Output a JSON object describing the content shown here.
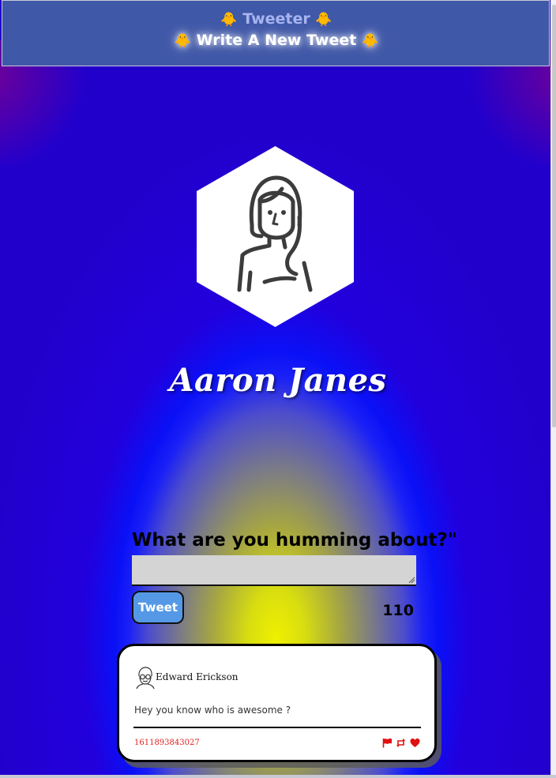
{
  "nav": {
    "logo_label": "Tweeter",
    "write_link_label": "Write A New Tweet",
    "chick_emoji": "🐥"
  },
  "profile": {
    "name": "Aaron Janes",
    "avatar_icon": "woman-avatar-icon"
  },
  "compose": {
    "label": "What are you humming about?\"",
    "input_value": "",
    "button_label": "Tweet",
    "counter": "110"
  },
  "tweets": [
    {
      "author": "Edward Erickson",
      "avatar_icon": "man-with-glasses-avatar-icon",
      "text": "Hey you know who is awesome ?",
      "timestamp": "1611893843027",
      "actions": [
        "flag-icon",
        "retweet-icon",
        "heart-icon"
      ]
    }
  ],
  "colors": {
    "nav_bg": "#4058a8",
    "page_bg": "#2200cc",
    "glow": "#f0f000",
    "button": "#5599e6",
    "timestamp": "#e02020",
    "action_icons": "#e01010"
  }
}
